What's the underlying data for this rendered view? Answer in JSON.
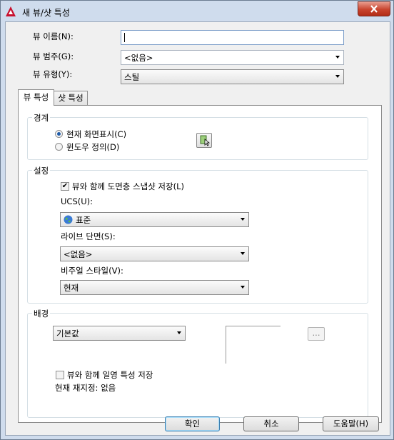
{
  "window": {
    "title": "새 뷰/샷 특성"
  },
  "fields": {
    "view_name_label": "뷰 이름(N):",
    "view_name_value": "",
    "view_category_label": "뷰 범주(G):",
    "view_category_value": "<없음>",
    "view_type_label": "뷰 유형(Y):",
    "view_type_value": "스틸"
  },
  "tabs": [
    {
      "label": "뷰 특성",
      "active": true
    },
    {
      "label": "샷 특성",
      "active": false
    }
  ],
  "boundary": {
    "title": "경계",
    "radio_current": "현재 화면표시(C)",
    "radio_window": "윈도우 정의(D)",
    "selected": "current"
  },
  "settings": {
    "title": "설정",
    "save_layer_label": "뷰와 함께 도면층 스냅샷 저장(L)",
    "save_layer_checked": true,
    "ucs_label": "UCS(U):",
    "ucs_value": "표준",
    "live_section_label": "라이브 단면(S):",
    "live_section_value": "<없음>",
    "visual_style_label": "비주얼 스타일(V):",
    "visual_style_value": "현재"
  },
  "background": {
    "title": "배경",
    "value": "기본값",
    "ellipsis_label": "...",
    "save_sun_label": "뷰와 함께 일영 특성 저장",
    "save_sun_checked": false,
    "current_override": "현재 재지정: 없음"
  },
  "buttons": {
    "ok": "확인",
    "cancel": "취소",
    "help": "도움말(H)"
  },
  "colors": {
    "accent": "#1f5ba8",
    "close": "#c8432d",
    "panel": "#ffffff"
  },
  "icons": {
    "app": "autocad-logo-icon",
    "close": "close-icon",
    "pick_window": "pick-window-icon",
    "ucs_globe": "globe-icon"
  }
}
